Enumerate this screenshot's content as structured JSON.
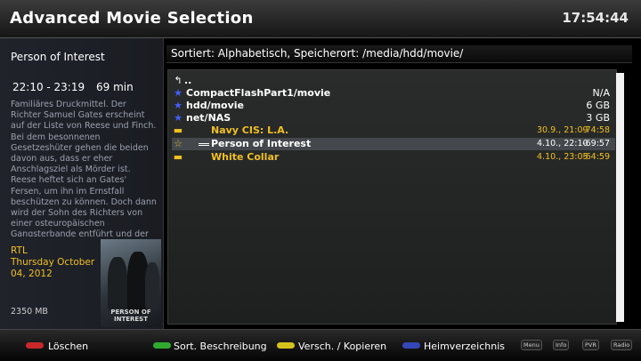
{
  "header": {
    "title": "Advanced Movie Selection",
    "clock": "17:54:44"
  },
  "info": {
    "title": "Person of Interest",
    "time_range": "22:10 - 23:19",
    "duration": "69 min",
    "description": "Familiäres Druckmittel. Der Richter Samuel Gates erscheint auf der Liste von Reese und Finch. Bei dem besonnenen Gesetzeshüter gehen die beiden davon aus, dass er eher Anschlagsziel als Mörder ist. Reese heftet sich an Gates' Fersen, um ihn im Ernstfall beschützen zu können. Doch dann wird der Sohn des Richters von einer osteuropäischen Gangsterbande entführt und der",
    "channel": "RTL",
    "date": "Thursday October 04, 2012",
    "size": "2350 MB",
    "poster_text": "PERSON OF INTEREST"
  },
  "path_bar": {
    "text": "Sortiert: Alphabetisch, Speicherort:  /media/hdd/movie/"
  },
  "list": {
    "up_label": "..",
    "locations": [
      {
        "name": "CompactFlashPart1/movie",
        "info": "N/A"
      },
      {
        "name": "hdd/movie",
        "info": "6 GB"
      },
      {
        "name": "net/NAS",
        "info": "3 GB"
      }
    ],
    "movies": [
      {
        "name": "Navy CIS: L.A.",
        "date": "30.9., 21:09",
        "length": "-74:58"
      },
      {
        "name": "Person of Interest",
        "date": "4.10., 22:10",
        "length": "-69:57"
      },
      {
        "name": "White Collar",
        "date": "4.10., 23:05",
        "length": "-64:59"
      }
    ]
  },
  "footer": {
    "red_label": "Löschen",
    "green_label": "Sort. Beschreibung",
    "yellow_label": "Versch. / Kopieren",
    "blue_label": "Heimverzeichnis",
    "mini_buttons": [
      "Menu",
      "Info",
      "PVR",
      "Radio"
    ]
  },
  "colors": {
    "red": "#c8282a",
    "green": "#2faa2f",
    "yellow": "#d4c21c",
    "blue": "#3447b8",
    "accent": "#f0c020"
  }
}
